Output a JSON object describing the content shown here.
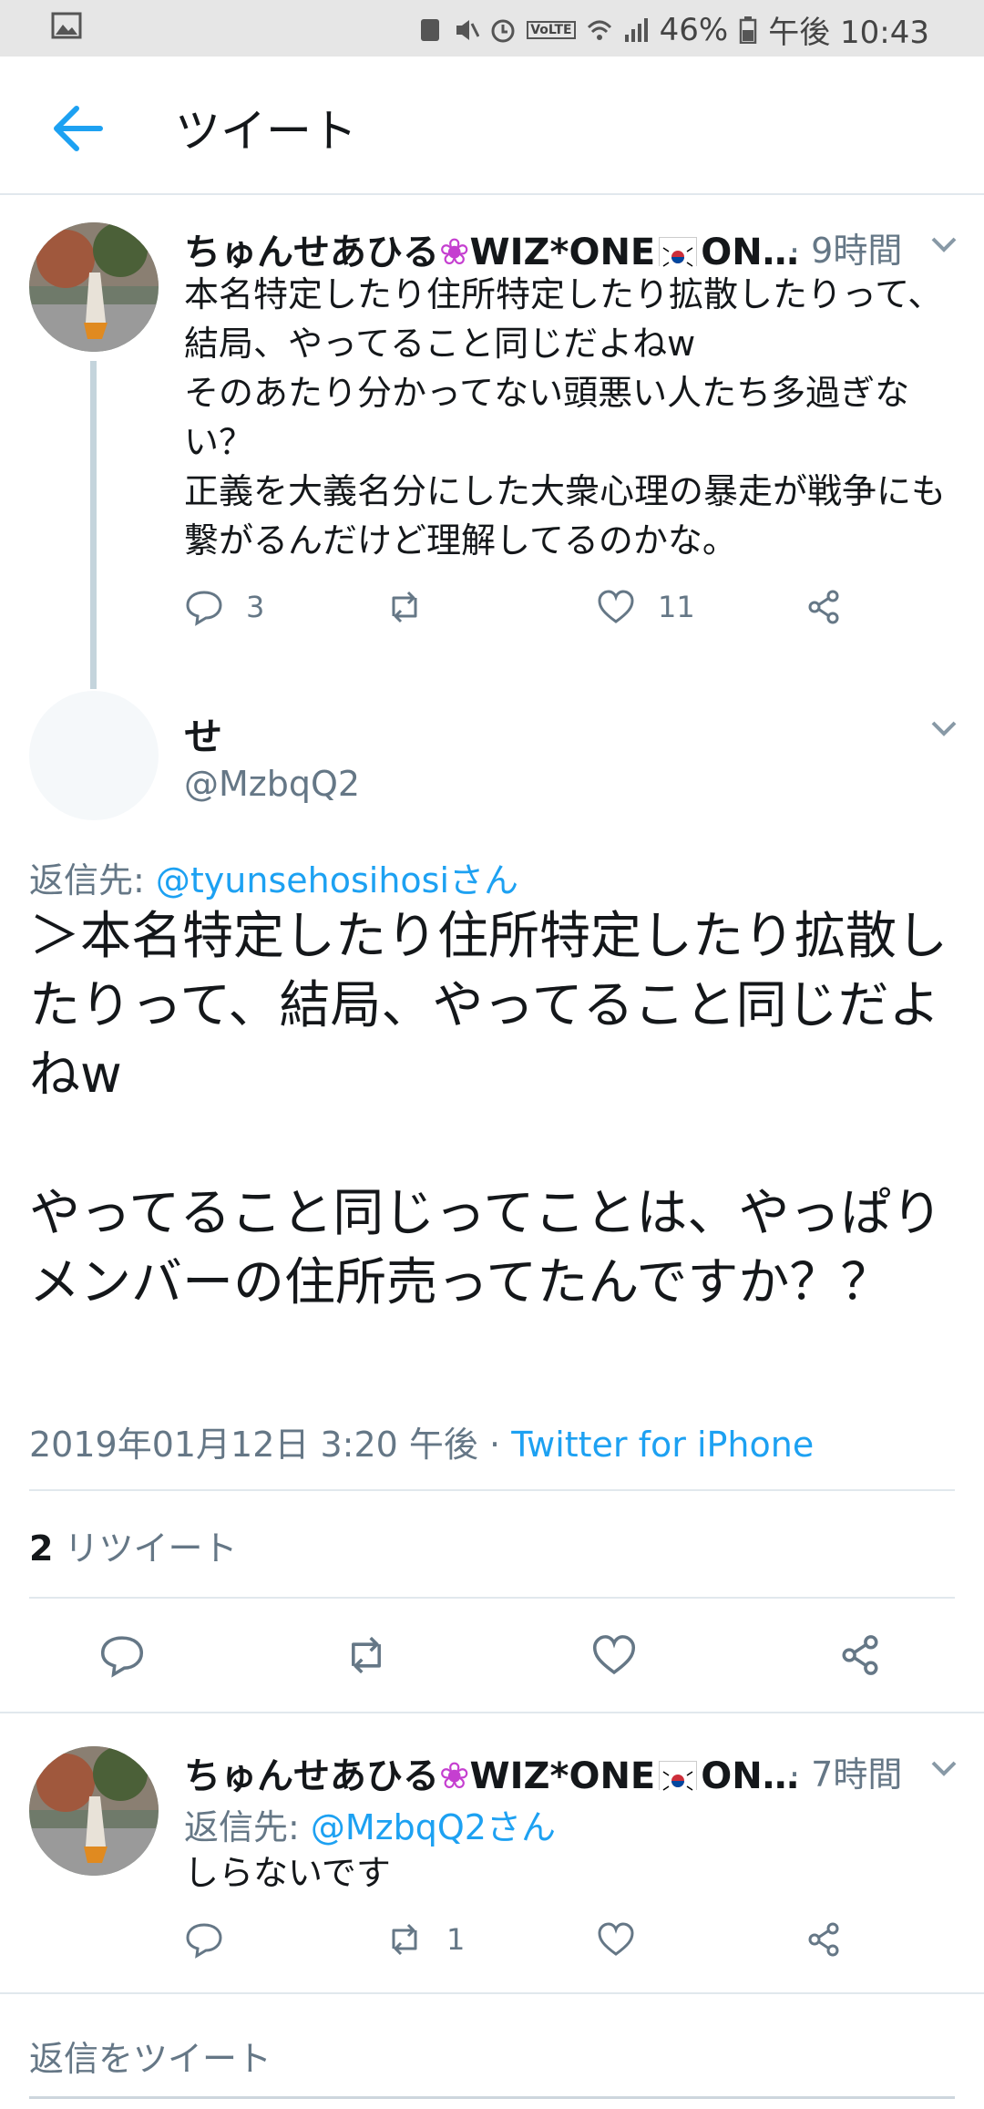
{
  "status_bar": {
    "battery": "46%",
    "time": "午後 10:43",
    "volte": "VoLTE"
  },
  "header": {
    "title": "ツイート",
    "back_icon": "arrow-left-icon"
  },
  "parent_tweet": {
    "name": "ちゅんせあひる",
    "name_tail": "WIZ*ONE",
    "name_end": "ON…",
    "time": "· 9時間",
    "text": "本名特定したり住所特定したり拡散したりって、結局、やってること同じだよねw\nそのあたり分かってない頭悪い人たち多過ぎない？\n正義を大義名分にした大衆心理の暴走が戦争にも繋がるんだけど理解してるのかな。",
    "replies": "3",
    "retweets": "",
    "likes": "11"
  },
  "main_tweet": {
    "name": "せ",
    "handle": "@MzbqQ2",
    "reply_to_label": "返信先:",
    "reply_to_user": "@tyunsehosihosiさん",
    "text": "＞本名特定したり住所特定したり拡散したりって、結局、やってること同じだよねw\n\nやってること同じってことは、やっぱりメンバーの住所売ってたんですか？？",
    "timestamp": "2019年01月12日 3:20 午後",
    "separator": "·",
    "source": "Twitter for iPhone",
    "retweet_count": "2",
    "retweet_label": "リツイート"
  },
  "reply_tweet": {
    "name": "ちゅんせあひる",
    "name_tail": "WIZ*ONE",
    "name_end": "ON…",
    "time": "· 7時間",
    "reply_to_label": "返信先:",
    "reply_to_user": "@MzbqQ2さん",
    "text": "しらないです",
    "replies": "",
    "retweets": "1",
    "likes": ""
  },
  "compose": {
    "placeholder": "返信をツイート"
  },
  "colors": {
    "accent": "#1da1f2",
    "secondary_text": "#657786",
    "divider": "#e1e8ed",
    "flower": "#c53fd0"
  }
}
